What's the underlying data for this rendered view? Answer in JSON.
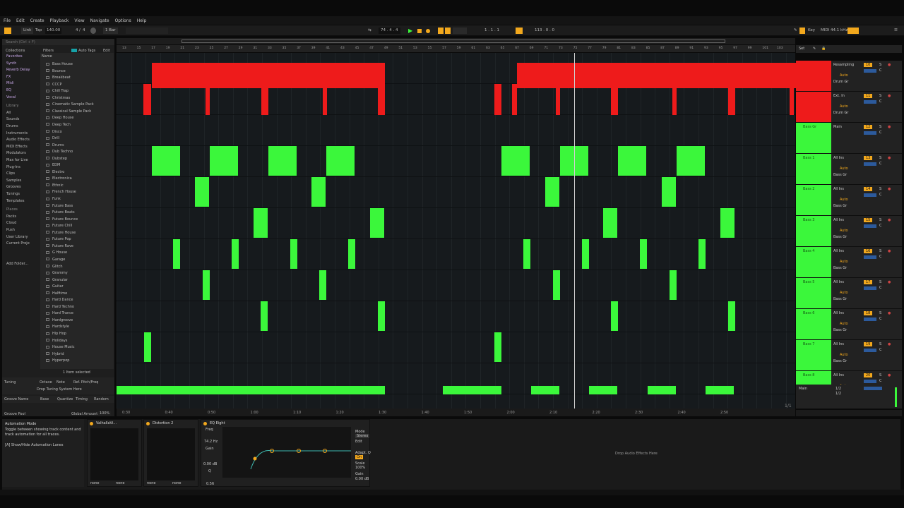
{
  "menu": [
    "File",
    "Edit",
    "Create",
    "Playback",
    "View",
    "Navigate",
    "Options",
    "Help"
  ],
  "transport": {
    "link": "Link",
    "tap": "Tap",
    "tempo": "140.00",
    "sig_num": "4",
    "sig_den": "4",
    "quantize": "1 Bar",
    "position": "74 . 4 . 4",
    "loop_start": "1 . 1 . 1",
    "loop_len": "113 . 0 . 0",
    "key": "Key",
    "midi": "MIDI",
    "cpu": "44.1 kHz"
  },
  "search_placeholder": "Search (Ctrl + F)",
  "browser": {
    "filters_label": "Filters",
    "autotag_label": "Auto Tags",
    "edit_label": "Edit",
    "name_header": "Name",
    "collections_header": "Collections",
    "collections": [
      "Favorites",
      "Synth",
      "Reverb Delay",
      "FX",
      "Midi",
      "EQ",
      "Vocal"
    ],
    "library_header": "Library",
    "library": [
      "All",
      "Sounds",
      "Drums",
      "Instruments",
      "Audio Effects",
      "MIDI Effects",
      "Modulators",
      "Max for Live",
      "Plug-Ins",
      "Clips",
      "Samples",
      "Grooves",
      "Tunings",
      "Templates"
    ],
    "places_header": "Places",
    "places": [
      "Packs",
      "Cloud",
      "Push",
      "User Library",
      "Current Proje",
      "",
      "",
      "Add Folder..."
    ],
    "items": [
      "Bass House",
      "Bounce",
      "Breakbeat",
      "CCCP",
      "Chill Trap",
      "Christmas",
      "Cinematic Sample Pack",
      "Classical Sample Pack",
      "Deep House",
      "Deep Tech",
      "Disco",
      "Drill",
      "Drums",
      "Dub Techno",
      "Dubstep",
      "EDM",
      "Electro",
      "Electronica",
      "Ethnic",
      "French House",
      "Funk",
      "Future Bass",
      "Future Beats",
      "Future Bounce",
      "Future Chill",
      "Future House",
      "Future Pop",
      "Future Rave",
      "G House",
      "Garage",
      "Glitch",
      "Grammy",
      "Granular",
      "Guitar",
      "Halftime",
      "Hard Dance",
      "Hard Techno",
      "Hard Trance",
      "Hardgroove",
      "Hardstyle",
      "Hip Hop",
      "Holidays",
      "House Music",
      "Hybrid",
      "Hyperpop"
    ],
    "selected_count": "1 Item selected",
    "tuning_label": "Tuning",
    "octave_label": "Octave",
    "note_label": "Note",
    "ref_label": "Ref. Pitch/Freq",
    "drop_tuning": "Drop Tuning System Here",
    "groove_name": "Groove Name",
    "base": "Base",
    "quantize": "Quantize",
    "timing": "Timing",
    "random": "Random",
    "groove_pool": "Groove Pool",
    "global_amount": "Global Amount",
    "global_amount_val": "100%"
  },
  "timeline": {
    "bars": [
      "13",
      "15",
      "17",
      "19",
      "21",
      "23",
      "25",
      "27",
      "29",
      "31",
      "33",
      "35",
      "37",
      "39",
      "41",
      "43",
      "45",
      "47",
      "49",
      "51",
      "53",
      "55",
      "57",
      "59",
      "61",
      "63",
      "65",
      "67",
      "69",
      "71",
      "73",
      "75",
      "77",
      "79",
      "81",
      "83",
      "85",
      "87",
      "89",
      "91",
      "93",
      "95",
      "97",
      "99",
      "101",
      "103"
    ],
    "times": [
      "0:30",
      "0:40",
      "0:50",
      "1:00",
      "1:10",
      "1:20",
      "1:30",
      "1:40",
      "1:50",
      "2:00",
      "2:10",
      "2:20",
      "2:30",
      "2:40",
      "2:50"
    ],
    "page": "1/1"
  },
  "mixer": {
    "set_label": "Set",
    "tracks": [
      {
        "name": "",
        "input": "Resampling",
        "mon": "Auto",
        "route": "Drum Gr",
        "vol": "10",
        "pan": "C"
      },
      {
        "name": "",
        "input": "Ext. In",
        "mon": "Auto",
        "route": "Drum Gr",
        "vol": "11",
        "pan": "C"
      },
      {
        "name": "Bass Gr",
        "input": "Main",
        "mon": "",
        "route": "",
        "vol": "12",
        "pan": "C"
      },
      {
        "name": "Bass 1",
        "input": "All Ins",
        "mon": "Auto",
        "route": "Bass Gr",
        "vol": "13",
        "pan": "C"
      },
      {
        "name": "Bass 2",
        "input": "All Ins",
        "mon": "Auto",
        "route": "Bass Gr",
        "vol": "14",
        "pan": "C"
      },
      {
        "name": "Bass 3",
        "input": "All Ins",
        "mon": "Auto",
        "route": "Bass Gr",
        "vol": "15",
        "pan": "C"
      },
      {
        "name": "Bass 4",
        "input": "All Ins",
        "mon": "Auto",
        "route": "Bass Gr",
        "vol": "16",
        "pan": "C"
      },
      {
        "name": "Bass 5",
        "input": "All Ins",
        "mon": "Auto",
        "route": "Bass Gr",
        "vol": "17",
        "pan": "C"
      },
      {
        "name": "Bass 6",
        "input": "All Ins",
        "mon": "Auto",
        "route": "Bass Gr",
        "vol": "18",
        "pan": "C"
      },
      {
        "name": "Bass 7",
        "input": "All Ins",
        "mon": "Auto",
        "route": "Bass Gr",
        "vol": "19",
        "pan": "C"
      },
      {
        "name": "Bass 8",
        "input": "All Ins",
        "mon": "Auto",
        "route": "Bass Gr",
        "vol": "20",
        "pan": "C"
      }
    ],
    "main_label": "Main",
    "main_out": "1/2"
  },
  "info": {
    "title": "Automation Mode",
    "body": "Toggle between showing track content and track automation for all traces.",
    "shortcut": "[A] Show/Hide Automation Lanes"
  },
  "devices": {
    "dev1": "ValhallaVi...",
    "dev2": "Distortion 2",
    "eq": "EQ Eight",
    "freq_label": "Freq",
    "freq_val": "74.2 Hz",
    "gain_label": "Gain",
    "gain_val": "0.00 dB",
    "q_label": "Q",
    "q_val": "0.56",
    "mode_label": "Mode",
    "mode_val": "Stereo",
    "edit_label": "Edit",
    "adapt_label": "Adapt. Q",
    "adapt_val": "On",
    "scale_label": "Scale",
    "scale_val": "100%",
    "gain2_label": "Gain",
    "gain2_val": "0.00 dB",
    "none1": "none",
    "none2": "none",
    "drop_fx": "Drop Audio Effects Here"
  },
  "colors": {
    "accent": "#f2a81d",
    "red_clip": "#ee1b1b",
    "green_clip": "#3bf73b"
  }
}
